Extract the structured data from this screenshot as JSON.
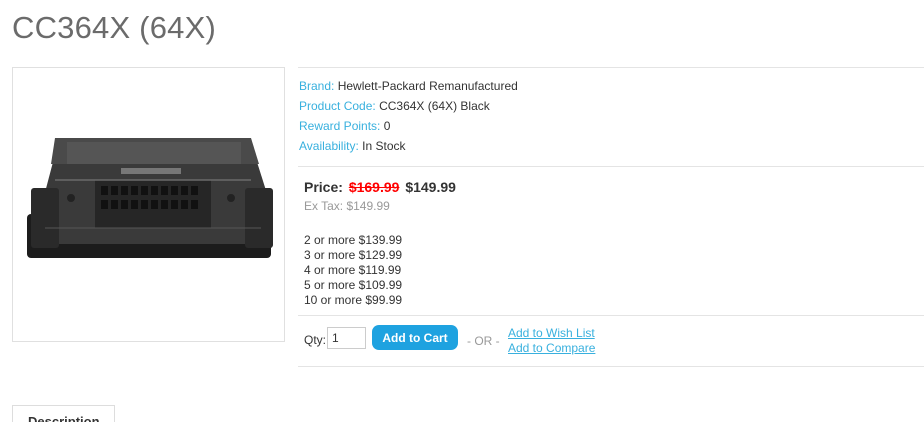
{
  "page": {
    "title": "CC364X (64X)"
  },
  "product": {
    "attributes": [
      {
        "key": "Brand:",
        "value": "Hewlett-Packard Remanufactured"
      },
      {
        "key": "Product Code:",
        "value": "CC364X (64X) Black"
      },
      {
        "key": "Reward Points:",
        "value": "0"
      },
      {
        "key": "Availability:",
        "value": "In Stock"
      }
    ],
    "price_label": "Price:",
    "price_old": "$169.99",
    "price_new": "$149.99",
    "ex_tax": "Ex Tax: $149.99",
    "discounts": [
      "2 or more $139.99",
      "3 or more $129.99",
      "4 or more $119.99",
      "5 or more $109.99",
      "10 or more $99.99"
    ]
  },
  "cart": {
    "qty_label": "Qty:",
    "qty_value": "1",
    "add_to_cart": "Add to Cart",
    "or_text": "- OR -",
    "wishlist": "Add to Wish List",
    "compare": "Add to Compare"
  },
  "tabs": [
    {
      "label": "Description"
    }
  ],
  "colors": {
    "accent": "#38b0de",
    "button": "#1ea2e0",
    "old_price": "#ff0000"
  }
}
